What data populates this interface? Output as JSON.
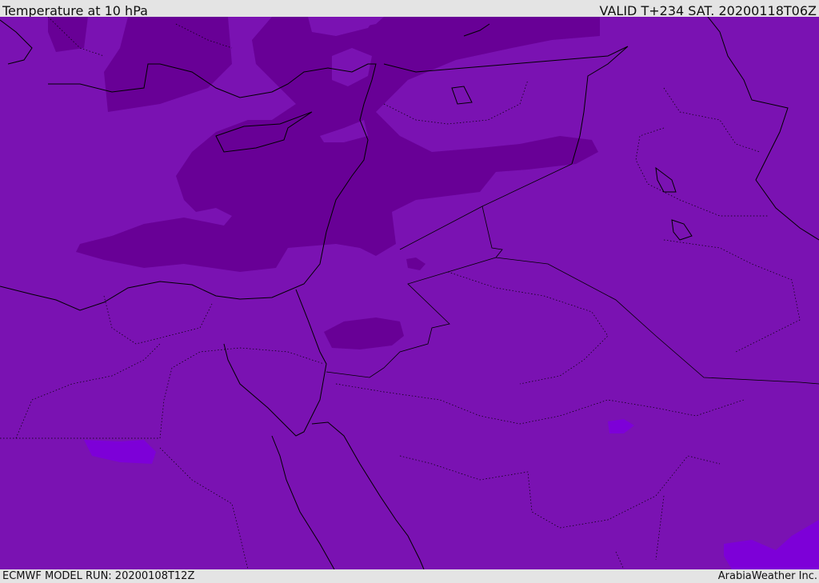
{
  "header": {
    "title": "Temperature at 10 hPa",
    "valid": "VALID T+234 SAT. 20200118T06Z"
  },
  "footer": {
    "model_run": "ECMWF MODEL RUN: 20200108T12Z",
    "credit": "ArabiaWeather Inc."
  },
  "colors": {
    "base": "#7a12b2",
    "cold": "#680096",
    "warm": "#7d00d8",
    "background": "#e4e4e4"
  }
}
